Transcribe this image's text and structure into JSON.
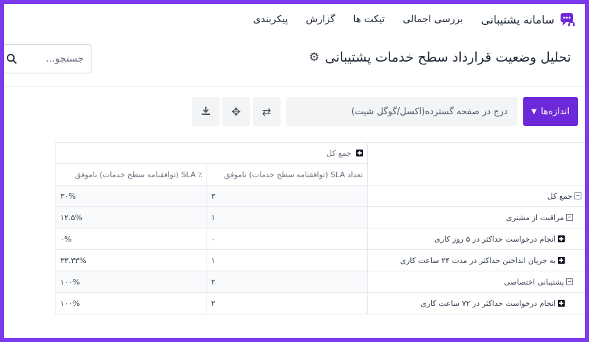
{
  "nav": {
    "brand": "سامانه پشتیبانی",
    "links": [
      "بررسی اجمالی",
      "تیکت ها",
      "گزارش",
      "پیکربندی"
    ]
  },
  "header": {
    "title": "تحلیل وضعیت قرارداد سطح خدمات پشتیبانی",
    "search_placeholder": "جستجو..."
  },
  "toolbar": {
    "measures_label": "اندازه‌ها",
    "export_label": "درج در صفحه گسترده(اکسل/گوگل شیت)"
  },
  "pivot": {
    "col_group": "جمع کل",
    "columns": [
      "تعداد SLA (توافقنامه سطح خدمات) ناموفق",
      "٪ SLA (توافقنامه سطح خدمات) ناموفق"
    ],
    "rows": [
      {
        "label": "جمع کل",
        "count": "۳",
        "percent": "۳۰%"
      },
      {
        "label": "مراقبت از مشتری",
        "count": "۱",
        "percent": "۱۲.۵%"
      },
      {
        "label": "انجام درخواست حداکثر در ۵ روز کاری",
        "count": "۰",
        "percent": "۰%"
      },
      {
        "label": "به جریان انداختن حداکثر در مدت ۲۴ ساعت کاری",
        "count": "۱",
        "percent": "۳۳.۳۳%"
      },
      {
        "label": "پشتیبانی اختصاصی",
        "count": "۲",
        "percent": "۱۰۰%"
      },
      {
        "label": "انجام درخواست حداکثر در ۷۲ ساعت کاری",
        "count": "۲",
        "percent": "۱۰۰%"
      }
    ]
  },
  "colors": {
    "accent": "#6d28d9",
    "frame": "#7c3aed"
  }
}
